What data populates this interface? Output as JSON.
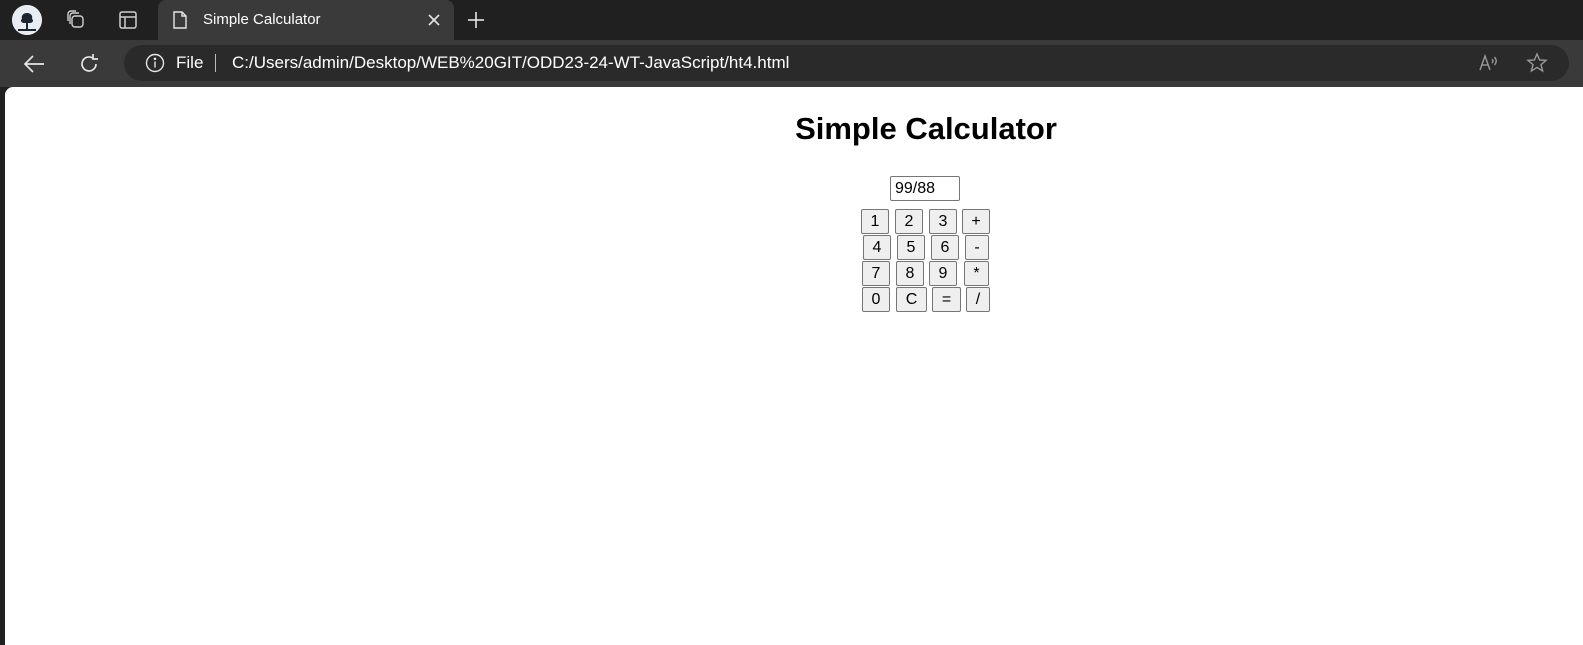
{
  "browser": {
    "tab": {
      "title": "Simple Calculator"
    },
    "address_bar": {
      "scheme_label": "File",
      "url": "C:/Users/admin/Desktop/WEB%20GIT/ODD23-24-WT-JavaScript/ht4.html"
    },
    "icons": {
      "profile": "profile-avatar",
      "workspaces": "workspaces-icon",
      "tab_actions": "tab-actions-icon",
      "page": "page-icon",
      "close": "close-icon",
      "new_tab": "plus-icon",
      "back": "back-arrow-icon",
      "refresh": "refresh-icon",
      "info": "info-icon",
      "read_aloud": "read-aloud-icon",
      "favorite": "star-icon"
    }
  },
  "page": {
    "heading": "Simple Calculator",
    "display_value": "99/88",
    "keys": {
      "k1": "1",
      "k2": "2",
      "k3": "3",
      "plus": "+",
      "k4": "4",
      "k5": "5",
      "k6": "6",
      "minus": "-",
      "k7": "7",
      "k8": "8",
      "k9": "9",
      "multiply": "*",
      "k0": "0",
      "clear": "C",
      "equals": "=",
      "divide": "/"
    }
  },
  "colors": {
    "chrome_dark": "#202020",
    "chrome_active": "#3a3a3a",
    "address_bg": "#2a2a2a",
    "page_bg": "#ffffff",
    "button_bg": "#efefef"
  }
}
